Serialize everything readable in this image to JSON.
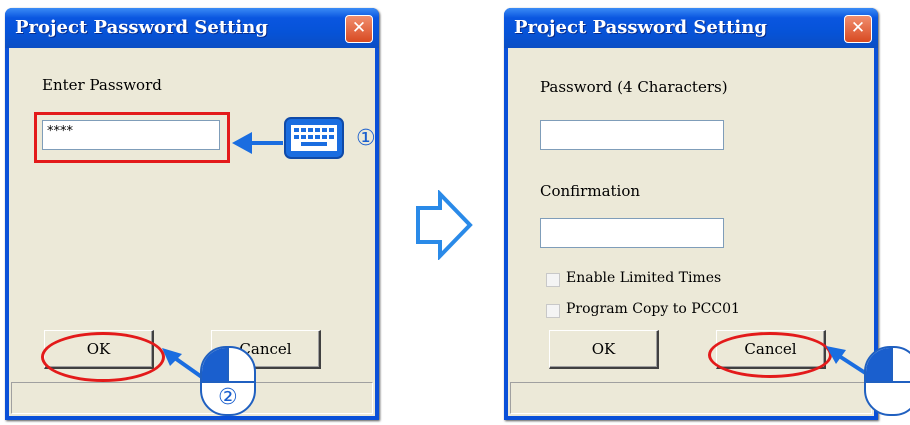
{
  "left_dialog": {
    "title": "Project Password Setting",
    "close_glyph": "✕",
    "enter_password_label": "Enter Password",
    "password_value": "****",
    "ok_label": "OK",
    "cancel_label": "Cancel"
  },
  "right_dialog": {
    "title": "Project Password Setting",
    "close_glyph": "✕",
    "password_label": "Password (4 Characters)",
    "password_value": "",
    "confirmation_label": "Confirmation",
    "confirmation_value": "",
    "checkbox_1_label": "Enable Limited Times",
    "checkbox_2_label": "Program Copy to PCC01",
    "ok_label": "OK",
    "cancel_label": "Cancel"
  },
  "annotations": {
    "step_1": "①",
    "step_2": "②",
    "highlight_color": "#e31a1a",
    "arrow_color": "#1a6de0",
    "icons": [
      "keyboard-icon",
      "mouse-icon",
      "next-step-arrow"
    ]
  }
}
